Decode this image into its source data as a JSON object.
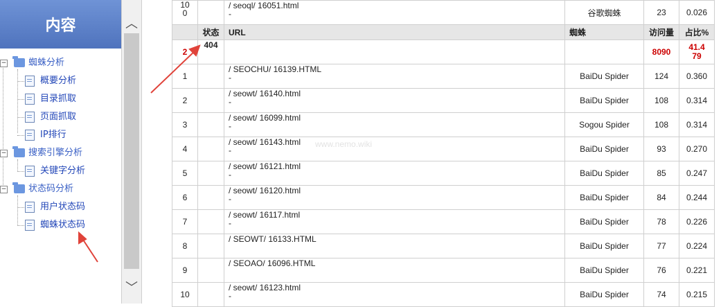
{
  "sidebar": {
    "title": "内容",
    "groups": [
      {
        "label": "蜘蛛分析",
        "items": [
          "概要分析",
          "目录抓取",
          "页面抓取",
          "IP排行"
        ]
      },
      {
        "label": "搜索引擎分析",
        "items": [
          "关键字分析"
        ]
      },
      {
        "label": "状态码分析",
        "items": [
          "用户状态码",
          "蜘蛛状态码"
        ]
      }
    ]
  },
  "table": {
    "top_partial_row": {
      "num": "10\n0",
      "url": "/ seoql/ 16051.html",
      "dash": "-",
      "spider": "谷歌蜘蛛",
      "visits": "23",
      "pct": "0.026"
    },
    "headers": {
      "status": "状态",
      "url": "URL",
      "spider": "蜘蛛",
      "visits": "访问量",
      "pct": "占比%"
    },
    "summary_row": {
      "num": "2",
      "status": "404",
      "url": "",
      "spider": "",
      "visits": "8090",
      "pct": "41.479"
    },
    "rows": [
      {
        "num": "1",
        "url": "/ SEOCHU/ 16139.HTML",
        "dash": "-",
        "spider": "BaiDu Spider",
        "visits": "124",
        "pct": "0.360"
      },
      {
        "num": "2",
        "url": "/ seowt/ 16140.html",
        "dash": "-",
        "spider": "BaiDu Spider",
        "visits": "108",
        "pct": "0.314"
      },
      {
        "num": "3",
        "url": "/ seowt/ 16099.html",
        "dash": "-",
        "spider": "Sogou Spider",
        "visits": "108",
        "pct": "0.314"
      },
      {
        "num": "4",
        "url": "/ seowt/ 16143.html",
        "dash": "-",
        "spider": "BaiDu Spider",
        "visits": "93",
        "pct": "0.270"
      },
      {
        "num": "5",
        "url": "/ seowt/ 16121.html",
        "dash": "-",
        "spider": "BaiDu Spider",
        "visits": "85",
        "pct": "0.247"
      },
      {
        "num": "6",
        "url": "/ seowt/ 16120.html",
        "dash": "-",
        "spider": "BaiDu Spider",
        "visits": "84",
        "pct": "0.244"
      },
      {
        "num": "7",
        "url": "/ seowt/ 16117.html",
        "dash": "-",
        "spider": "BaiDu Spider",
        "visits": "78",
        "pct": "0.226"
      },
      {
        "num": "8",
        "url": "/ SEOWT/ 16133.HTML",
        "dash": "",
        "spider": "BaiDu Spider",
        "visits": "77",
        "pct": "0.224"
      },
      {
        "num": "9",
        "url": "/ SEOAO/ 16096.HTML",
        "dash": "",
        "spider": "BaiDu Spider",
        "visits": "76",
        "pct": "0.221"
      },
      {
        "num": "10",
        "url": "/ seowt/ 16123.html",
        "dash": "-",
        "spider": "BaiDu Spider",
        "visits": "74",
        "pct": "0.215"
      }
    ]
  },
  "colors": {
    "header_blue": "#5b7fc8",
    "link_blue": "#2347b8",
    "alert_red": "#c00000"
  }
}
